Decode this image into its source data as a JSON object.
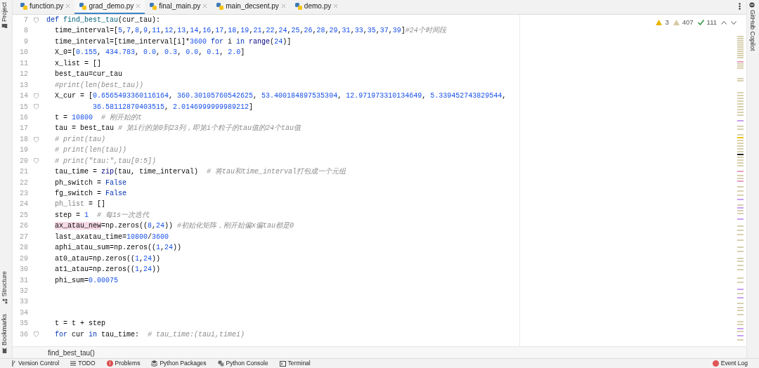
{
  "left_strip": {
    "top": [
      {
        "label": "Project"
      }
    ],
    "bottom": [
      {
        "label": "Structure",
        "kind": "structure"
      },
      {
        "label": "Bookmarks",
        "kind": "bookmark"
      }
    ]
  },
  "tabs": [
    {
      "label": "function.py",
      "selected": false
    },
    {
      "label": "grad_demo.py",
      "selected": true
    },
    {
      "label": "final_main.py",
      "selected": false
    },
    {
      "label": "main_decsent.py",
      "selected": false
    },
    {
      "label": "demo.py",
      "selected": false
    }
  ],
  "inspections": {
    "warnings": "3",
    "weak_warnings": "407",
    "typos": "111"
  },
  "code_lines": [
    {
      "number": "7",
      "fold": true,
      "kind": "def",
      "tokens": [
        {
          "kind": "kw",
          "t": "def"
        },
        {
          "kind": "fn",
          "t": " find_best_tau"
        },
        {
          "kind": "p",
          "t": "(cur_tau):"
        }
      ]
    },
    {
      "number": "8",
      "fold": false,
      "kind": "body",
      "tokens": [
        {
          "kind": "p",
          "t": "time_interval=["
        },
        {
          "kind": "nums",
          "t": "5,7,8,9,11,12,13,14,16,17,18,19,21,22,24,25,26,28,29,31,33,35,37,39"
        },
        {
          "kind": "p",
          "t": "]"
        },
        {
          "kind": "cm",
          "t": "#24个时间段"
        }
      ]
    },
    {
      "number": "9",
      "fold": false,
      "kind": "body",
      "tokens": [
        {
          "kind": "p",
          "t": "time_interval=[time_interval[i]*"
        },
        {
          "kind": "num",
          "t": "3600"
        },
        {
          "kind": "kw",
          "t": " for"
        },
        {
          "kind": "p",
          "t": " i"
        },
        {
          "kind": "kw",
          "t": " in"
        },
        {
          "kind": "bi",
          "t": " range"
        },
        {
          "kind": "p",
          "t": "("
        },
        {
          "kind": "num",
          "t": "24"
        },
        {
          "kind": "p",
          "t": ")]"
        }
      ]
    },
    {
      "number": "10",
      "fold": false,
      "kind": "body",
      "tokens": [
        {
          "kind": "p",
          "t": "X_0=["
        },
        {
          "kind": "nums",
          "t": "0.155, 434.783, 0.0, 0.3, 0.0, 0.1, 2.0"
        },
        {
          "kind": "p",
          "t": "]"
        }
      ]
    },
    {
      "number": "11",
      "fold": false,
      "kind": "body",
      "tokens": [
        {
          "kind": "p",
          "t": "x_list = []"
        }
      ]
    },
    {
      "number": "12",
      "fold": false,
      "kind": "body",
      "tokens": [
        {
          "kind": "p",
          "t": "best_tau=cur_tau"
        }
      ]
    },
    {
      "number": "13",
      "fold": false,
      "kind": "body",
      "tokens": [
        {
          "kind": "cm",
          "t": "#print(len(best_tau))"
        }
      ]
    },
    {
      "number": "14",
      "fold": true,
      "kind": "body",
      "tokens": [
        {
          "kind": "p",
          "t": "X_cur = ["
        },
        {
          "kind": "nums",
          "t": "0.6565493360116164, 360.30105760542625, 53.400184897535304, 12.971973310134649, 5.339452743829544"
        },
        {
          "kind": "p",
          "t": ","
        }
      ]
    },
    {
      "number": "15",
      "fold": true,
      "kind": "continuation",
      "tokens": [
        {
          "kind": "nums",
          "t": "36.58112870403515, 2.0146999999989212"
        },
        {
          "kind": "p",
          "t": "]"
        }
      ]
    },
    {
      "number": "16",
      "fold": false,
      "kind": "body",
      "tokens": [
        {
          "kind": "p",
          "t": "t = "
        },
        {
          "kind": "num",
          "t": "10800"
        },
        {
          "kind": "cm",
          "t": "  # 刚开始的t"
        }
      ]
    },
    {
      "number": "17",
      "fold": false,
      "kind": "body",
      "tokens": [
        {
          "kind": "p",
          "t": "tau = best_tau "
        },
        {
          "kind": "cm",
          "t": "# 第i行的第0到23列，即第i个粒子的tau值的24个tau值"
        }
      ]
    },
    {
      "number": "18",
      "fold": true,
      "kind": "body",
      "tokens": [
        {
          "kind": "cm",
          "t": "# print(tau)"
        }
      ]
    },
    {
      "number": "19",
      "fold": false,
      "kind": "body",
      "tokens": [
        {
          "kind": "cm",
          "t": "# print(len(tau))"
        }
      ]
    },
    {
      "number": "20",
      "fold": true,
      "kind": "body",
      "tokens": [
        {
          "kind": "cm",
          "t": "# print(\"tau:\",tau[0:5])"
        }
      ]
    },
    {
      "number": "21",
      "fold": false,
      "kind": "body",
      "tokens": [
        {
          "kind": "p",
          "t": "tau_time = "
        },
        {
          "kind": "bi",
          "t": "zip"
        },
        {
          "kind": "p",
          "t": "(tau, time_interval)"
        },
        {
          "kind": "cm",
          "t": "  # 将tau和time_interval打包成一个元组"
        }
      ]
    },
    {
      "number": "22",
      "fold": false,
      "kind": "body",
      "tokens": [
        {
          "kind": "p",
          "t": "ph_switch = "
        },
        {
          "kind": "kw",
          "t": "False"
        }
      ]
    },
    {
      "number": "23",
      "fold": false,
      "kind": "body",
      "tokens": [
        {
          "kind": "p",
          "t": "fg_switch = "
        },
        {
          "kind": "kw",
          "t": "False"
        }
      ]
    },
    {
      "number": "24",
      "fold": false,
      "kind": "body",
      "tokens": [
        {
          "kind": "unused",
          "t": "ph_list"
        },
        {
          "kind": "p",
          "t": " = []"
        }
      ]
    },
    {
      "number": "25",
      "fold": false,
      "kind": "body",
      "tokens": [
        {
          "kind": "p",
          "t": "step = "
        },
        {
          "kind": "num",
          "t": "1"
        },
        {
          "kind": "cm",
          "t": "  # 每1s一次迭代"
        }
      ]
    },
    {
      "number": "26",
      "fold": false,
      "kind": "body",
      "tokens": [
        {
          "kind": "hl",
          "t": "ax_atau_new"
        },
        {
          "kind": "p",
          "t": "=np.zeros(("
        },
        {
          "kind": "nums",
          "t": "8,24"
        },
        {
          "kind": "p",
          "t": "))"
        },
        {
          "kind": "cm",
          "t": " #初始化矩阵，刚开始偏x偏tau都是0"
        }
      ]
    },
    {
      "number": "27",
      "fold": false,
      "kind": "body",
      "tokens": [
        {
          "kind": "p",
          "t": "last_axatau_time="
        },
        {
          "kind": "num",
          "t": "10800"
        },
        {
          "kind": "p",
          "t": "/"
        },
        {
          "kind": "num",
          "t": "3600"
        }
      ]
    },
    {
      "number": "28",
      "fold": false,
      "kind": "body",
      "tokens": [
        {
          "kind": "p",
          "t": "aphi_atau_sum=np.zeros(("
        },
        {
          "kind": "nums",
          "t": "1,24"
        },
        {
          "kind": "p",
          "t": "))"
        }
      ]
    },
    {
      "number": "29",
      "fold": false,
      "kind": "body",
      "tokens": [
        {
          "kind": "p",
          "t": "at0_atau=np.zeros(("
        },
        {
          "kind": "nums",
          "t": "1,24"
        },
        {
          "kind": "p",
          "t": "))"
        }
      ]
    },
    {
      "number": "30",
      "fold": false,
      "kind": "body",
      "tokens": [
        {
          "kind": "p",
          "t": "at1_atau=np.zeros(("
        },
        {
          "kind": "nums",
          "t": "1,24"
        },
        {
          "kind": "p",
          "t": "))"
        }
      ]
    },
    {
      "number": "31",
      "fold": false,
      "kind": "body",
      "tokens": [
        {
          "kind": "p",
          "t": "phi_sum="
        },
        {
          "kind": "num",
          "t": "0.00075"
        }
      ]
    },
    {
      "number": "32",
      "fold": false
    },
    {
      "number": "33",
      "fold": false
    },
    {
      "number": "34",
      "fold": false
    },
    {
      "number": "35",
      "fold": false,
      "kind": "body",
      "tokens": [
        {
          "kind": "p",
          "t": "t = t + step"
        }
      ]
    },
    {
      "number": "36",
      "fold": true,
      "kind": "body",
      "tokens": [
        {
          "kind": "kw",
          "t": "for"
        },
        {
          "kind": "p",
          "t": " cur"
        },
        {
          "kind": "kw",
          "t": " in"
        },
        {
          "kind": "p",
          "t": " tau_time:"
        },
        {
          "kind": "cm",
          "t": "  # tau_time:(taui,timei)"
        }
      ]
    }
  ],
  "right_strip": {
    "label": "GitHub Copilot"
  },
  "breadcrumb": "find_best_tau()",
  "status_bar": {
    "items": [
      {
        "label": "Version Control",
        "kind": "branch"
      },
      {
        "label": "TODO",
        "kind": "list"
      },
      {
        "label": "Problems",
        "kind": "problems"
      },
      {
        "label": "Python Packages",
        "kind": "layers"
      },
      {
        "label": "Python Console",
        "kind": "python"
      },
      {
        "label": "Terminal",
        "kind": "terminal"
      }
    ],
    "event_log": {
      "label": "Event Log"
    }
  }
}
